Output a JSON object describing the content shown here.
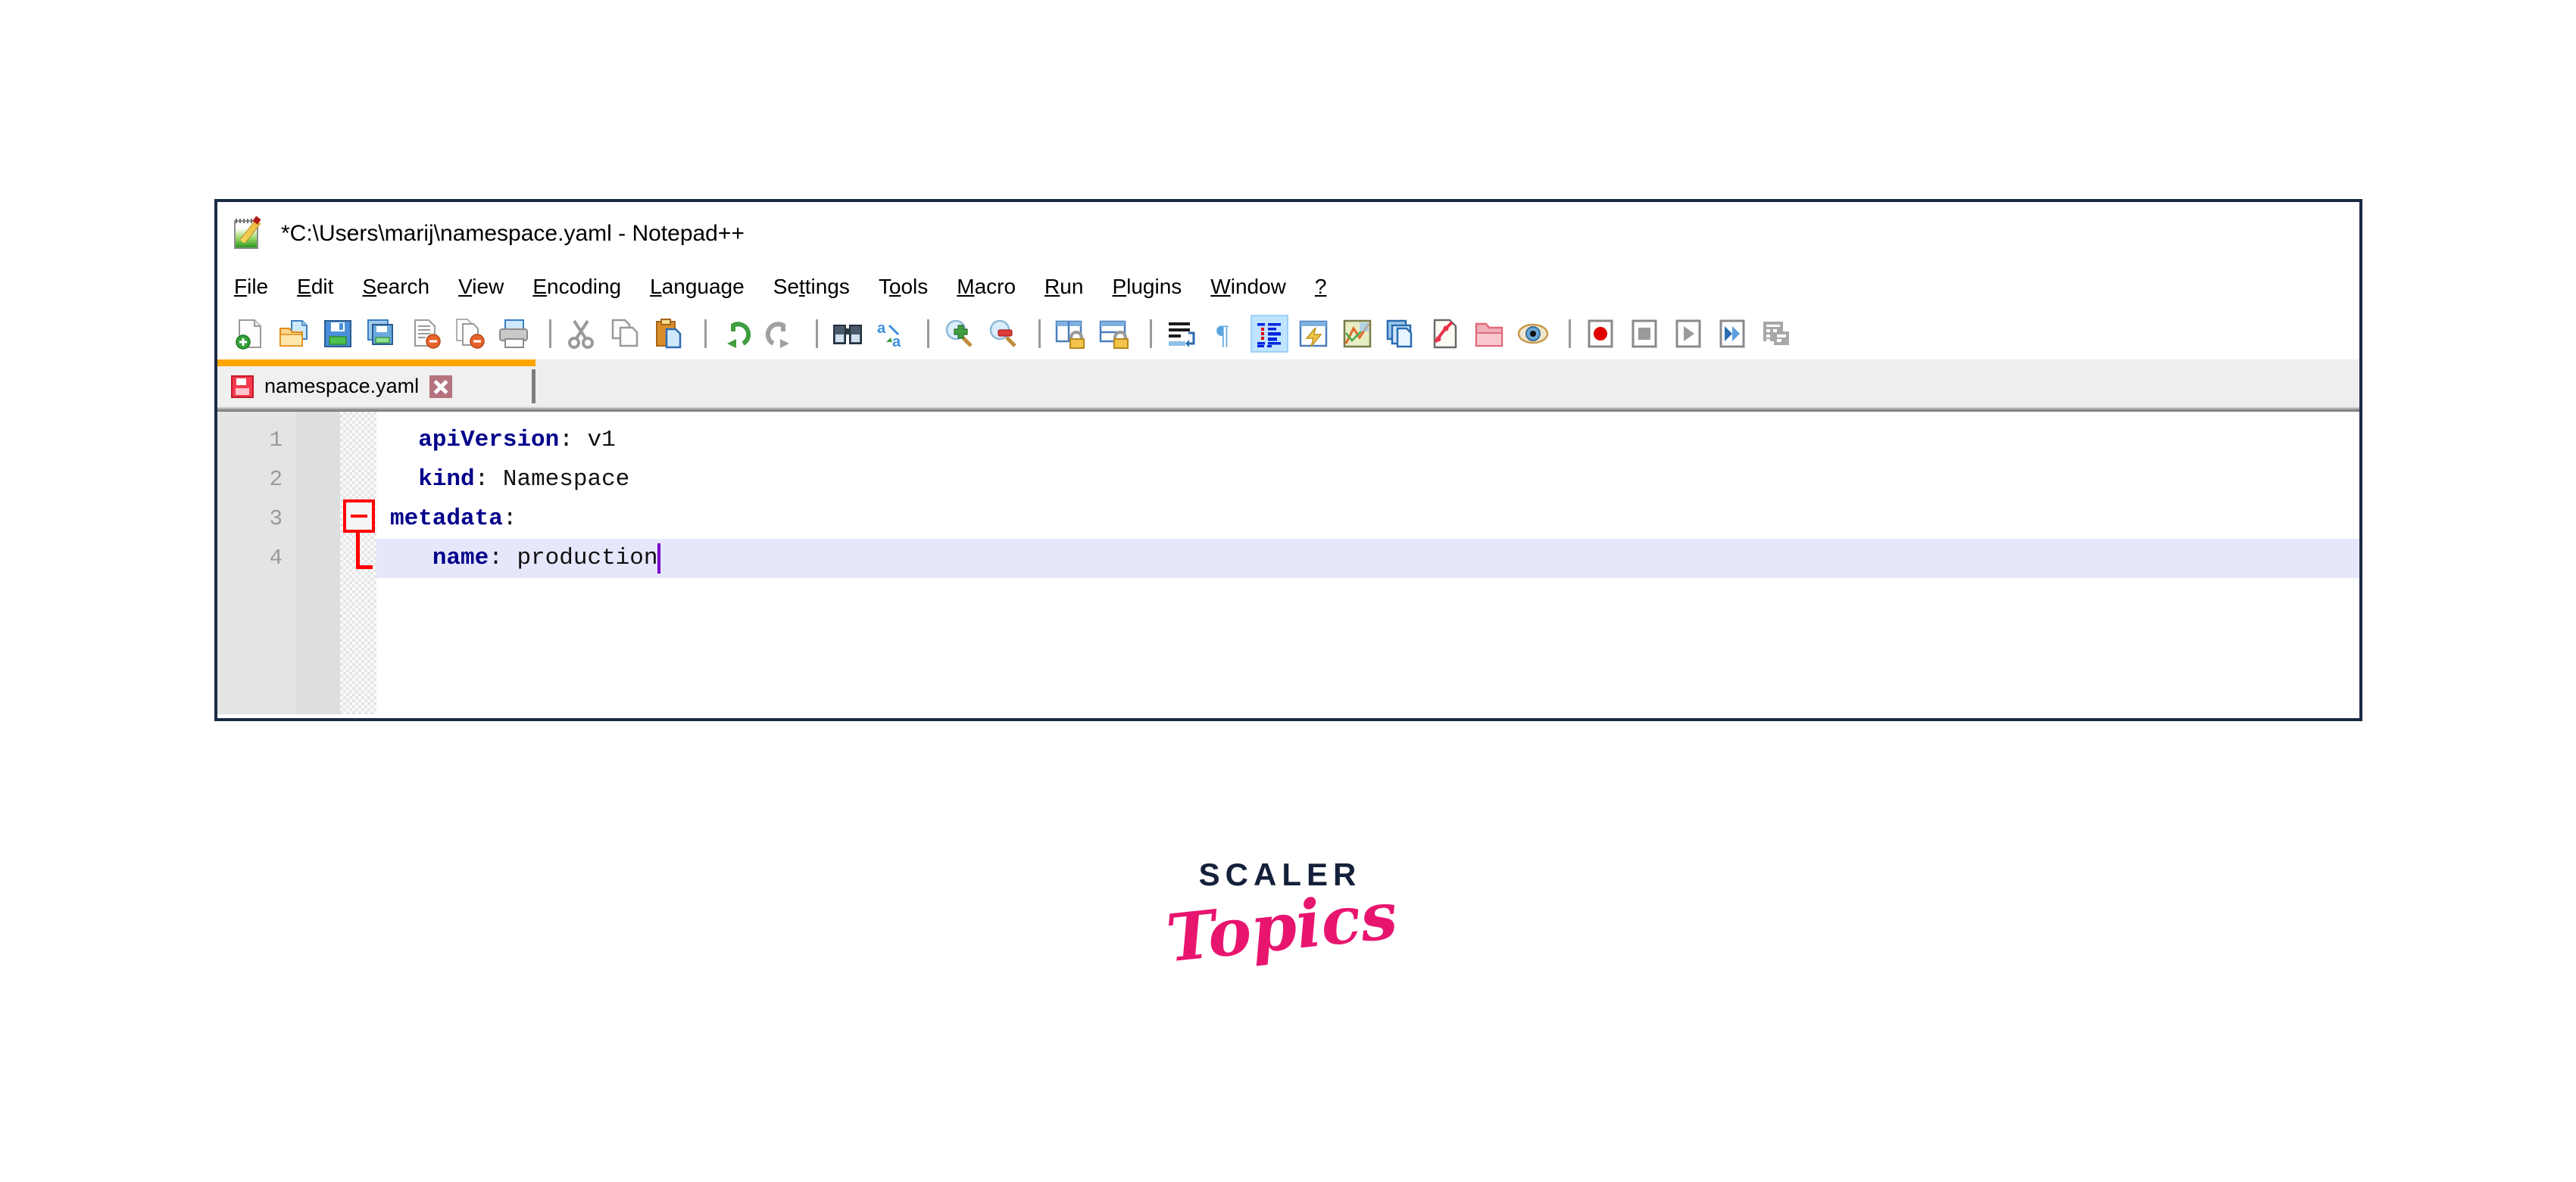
{
  "window": {
    "title": "*C:\\Users\\marij\\namespace.yaml - Notepad++",
    "app_icon": "notepad-plus-plus-icon",
    "border_color": "#1b2a45"
  },
  "menu": {
    "items": [
      {
        "label": "File",
        "mnemonic": "F",
        "rest": "ile"
      },
      {
        "label": "Edit",
        "mnemonic": "E",
        "rest": "dit"
      },
      {
        "label": "Search",
        "mnemonic": "S",
        "rest": "earch"
      },
      {
        "label": "View",
        "mnemonic": "V",
        "rest": "iew"
      },
      {
        "label": "Encoding",
        "mnemonic": "E",
        "rest": "ncoding",
        "pre": "E",
        "post": "ncoding"
      },
      {
        "label": "Language",
        "mnemonic": "L",
        "rest": "anguage"
      },
      {
        "label": "Settings",
        "mnemonic": "t",
        "rest": "ings",
        "pre": "Se",
        "post": "ings"
      },
      {
        "label": "Tools",
        "mnemonic": "o",
        "rest": "ols",
        "pre": "T",
        "post": "ols"
      },
      {
        "label": "Macro",
        "mnemonic": "M",
        "rest": "acro"
      },
      {
        "label": "Run",
        "mnemonic": "R",
        "rest": "un"
      },
      {
        "label": "Plugins",
        "mnemonic": "P",
        "rest": "lugins"
      },
      {
        "label": "Window",
        "mnemonic": "W",
        "rest": "indow"
      },
      {
        "label": "?",
        "mnemonic": "?",
        "rest": ""
      }
    ]
  },
  "toolbar": {
    "buttons": [
      {
        "name": "new-file-icon",
        "tooltip": "New"
      },
      {
        "name": "open-file-icon",
        "tooltip": "Open"
      },
      {
        "name": "save-icon",
        "tooltip": "Save"
      },
      {
        "name": "save-all-icon",
        "tooltip": "Save All"
      },
      {
        "name": "close-file-icon",
        "tooltip": "Close"
      },
      {
        "name": "close-all-files-icon",
        "tooltip": "Close All"
      },
      {
        "name": "print-icon",
        "tooltip": "Print"
      },
      {
        "name": "cut-icon",
        "tooltip": "Cut"
      },
      {
        "name": "copy-icon",
        "tooltip": "Copy"
      },
      {
        "name": "paste-icon",
        "tooltip": "Paste"
      },
      {
        "name": "undo-icon",
        "tooltip": "Undo"
      },
      {
        "name": "redo-icon",
        "tooltip": "Redo"
      },
      {
        "name": "find-icon",
        "tooltip": "Find"
      },
      {
        "name": "replace-icon",
        "tooltip": "Replace"
      },
      {
        "name": "zoom-in-icon",
        "tooltip": "Zoom In"
      },
      {
        "name": "zoom-out-icon",
        "tooltip": "Zoom Out"
      },
      {
        "name": "sync-vertical-scroll-icon",
        "tooltip": "Synchronize Vertical Scrolling"
      },
      {
        "name": "sync-horizontal-scroll-icon",
        "tooltip": "Synchronize Horizontal Scrolling"
      },
      {
        "name": "word-wrap-icon",
        "tooltip": "Word wrap"
      },
      {
        "name": "show-all-characters-icon",
        "tooltip": "Show All Characters"
      },
      {
        "name": "indent-guide-icon",
        "tooltip": "Show Indent Guide",
        "active": true
      },
      {
        "name": "user-defined-dialog-icon",
        "tooltip": "User-Defined Dialogue"
      },
      {
        "name": "document-map-icon",
        "tooltip": "Document Map"
      },
      {
        "name": "document-list-icon",
        "tooltip": "Document List"
      },
      {
        "name": "function-list-icon",
        "tooltip": "Function List"
      },
      {
        "name": "folder-as-workspace-icon",
        "tooltip": "Folder as Workspace"
      },
      {
        "name": "monitoring-icon",
        "tooltip": "Monitoring"
      },
      {
        "name": "macro-record-icon",
        "tooltip": "Start Recording"
      },
      {
        "name": "macro-stop-icon",
        "tooltip": "Stop Recording"
      },
      {
        "name": "macro-play-icon",
        "tooltip": "Playback"
      },
      {
        "name": "macro-run-multiple-icon",
        "tooltip": "Run a Macro Multiple Times"
      },
      {
        "name": "macro-save-icon",
        "tooltip": "Save Current Recorded Macro"
      }
    ]
  },
  "tabs": {
    "active_index": 0,
    "items": [
      {
        "label": "namespace.yaml",
        "modified": true,
        "save_icon": "floppy-unsaved-icon",
        "close_icon": "close-tab-icon",
        "accent_color": "#ffa500"
      }
    ]
  },
  "editor": {
    "language": "YAML",
    "caret_line": 4,
    "caret_column": 19,
    "highlight_color": "#e7e7fb",
    "fold": {
      "line": 3,
      "state": "expanded",
      "marker_color": "#ff0000"
    },
    "lines": [
      {
        "number": "1",
        "indent": "  ",
        "key": "apiVersion",
        "sep": ": ",
        "value": "v1",
        "highlight": false
      },
      {
        "number": "2",
        "indent": "  ",
        "key": "kind",
        "sep": ": ",
        "value": "Namespace",
        "highlight": false
      },
      {
        "number": "3",
        "indent": "",
        "key": "metadata",
        "sep": ":",
        "value": "",
        "highlight": false
      },
      {
        "number": "4",
        "indent": "   ",
        "key": "name",
        "sep": ": ",
        "value": "production",
        "highlight": true
      }
    ]
  },
  "logo": {
    "primary": "SCALER",
    "secondary": "Topics",
    "primary_color": "#15203a",
    "secondary_color": "#e8156f"
  }
}
